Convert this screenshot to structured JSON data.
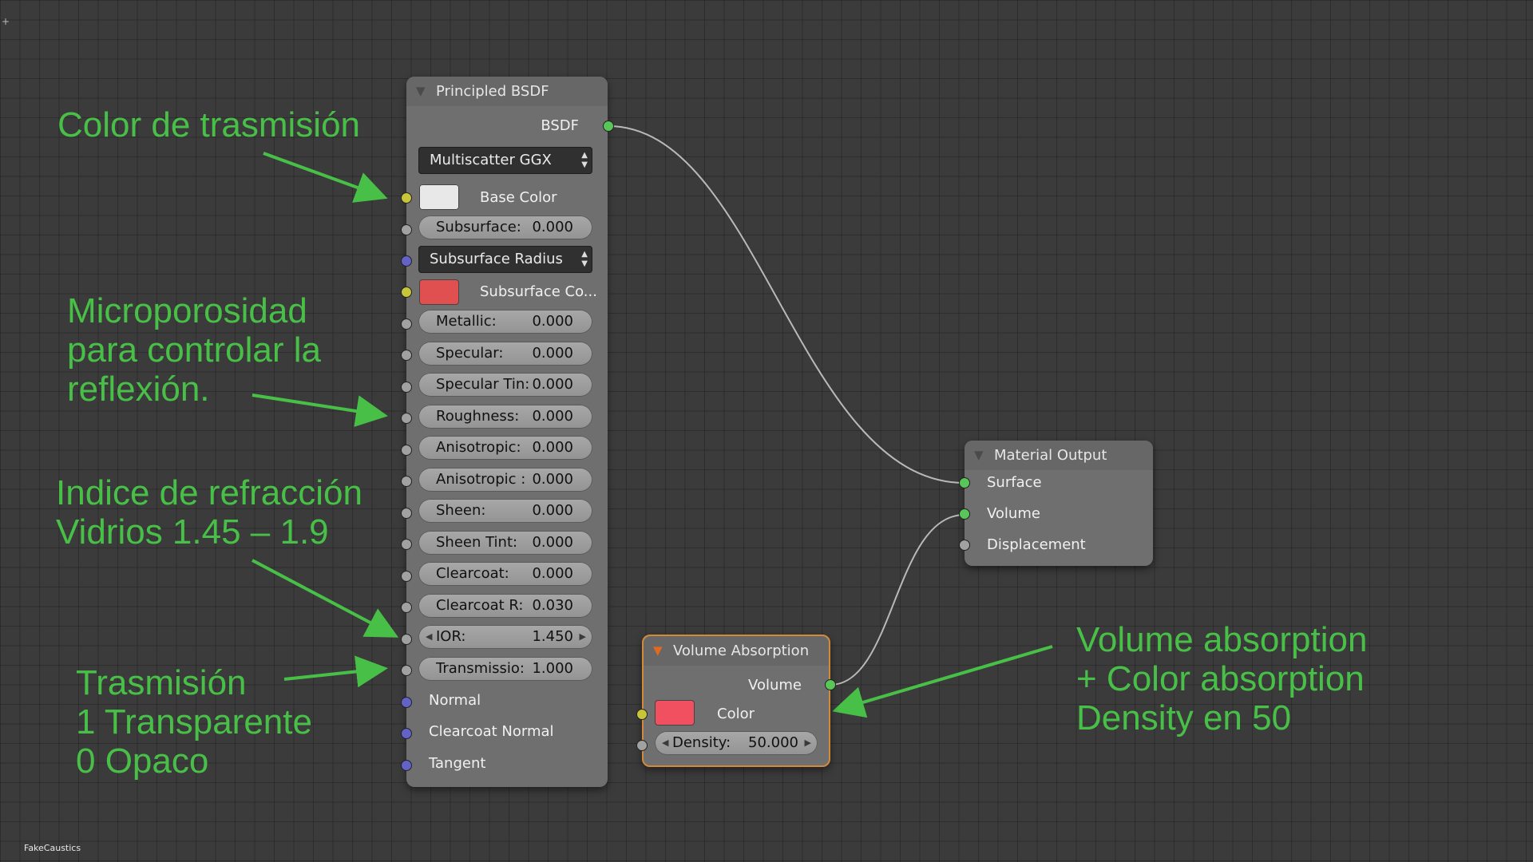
{
  "principled": {
    "title": "Principled BSDF",
    "output": "BSDF",
    "distribution": "Multiscatter GGX",
    "base_color_label": "Base Color",
    "base_color": "#e8e8e8",
    "subsurface": {
      "label": "Subsurface:",
      "value": "0.000"
    },
    "subsurface_method": "Subsurface Radius",
    "subsurface_color_label": "Subsurface Co...",
    "subsurface_color": "#e05050",
    "metallic": {
      "label": "Metallic:",
      "value": "0.000"
    },
    "specular": {
      "label": "Specular:",
      "value": "0.000"
    },
    "specular_tint": {
      "label": "Specular Tin:",
      "value": "0.000"
    },
    "roughness": {
      "label": "Roughness:",
      "value": "0.000"
    },
    "anisotropic": {
      "label": "Anisotropic:",
      "value": "0.000"
    },
    "anisotropic_rot": {
      "label": "Anisotropic :",
      "value": "0.000"
    },
    "sheen": {
      "label": "Sheen:",
      "value": "0.000"
    },
    "sheen_tint": {
      "label": "Sheen Tint:",
      "value": "0.000"
    },
    "clearcoat": {
      "label": "Clearcoat:",
      "value": "0.000"
    },
    "clearcoat_r": {
      "label": "Clearcoat R:",
      "value": "0.030"
    },
    "ior": {
      "label": "IOR:",
      "value": "1.450"
    },
    "transmission": {
      "label": "Transmissio:",
      "value": "1.000"
    },
    "normal": "Normal",
    "clearcoat_normal": "Clearcoat Normal",
    "tangent": "Tangent"
  },
  "material_output": {
    "title": "Material Output",
    "surface": "Surface",
    "volume": "Volume",
    "displacement": "Displacement"
  },
  "volume_absorption": {
    "title": "Volume Absorption",
    "output": "Volume",
    "color_label": "Color",
    "color": "#f05060",
    "density": {
      "label": "Density:",
      "value": "50.000"
    }
  },
  "annotations": {
    "transmission_color": "Color de trasmisión",
    "microporosity": "Microporosidad\npara controlar la\nreflexión.",
    "ior": "Indice de refracción\nVidrios 1.45 – 1.9",
    "transmission": "Trasmisión\n1 Transparente\n0 Opaco",
    "volume": "Volume absorption\n+ Color absorption\nDensity en 50"
  },
  "footer": "FakeCaustics",
  "colors": {
    "annotation_green": "#48c048",
    "socket_green": "#59c659",
    "socket_yellow": "#c8c53a",
    "socket_gray": "#a1a1a1",
    "socket_blue": "#6363c7",
    "selected_border": "#d08a3a"
  }
}
